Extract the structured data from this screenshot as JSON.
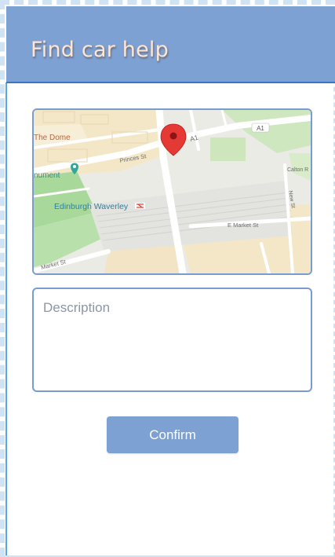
{
  "header": {
    "title": "Find car help"
  },
  "map": {
    "labels": {
      "the_dome": "The Dome",
      "princes_st": "Princes St",
      "a1_road": "A1",
      "a1_shield": "A1",
      "monument": "nument",
      "edinburgh_waverley": "Edinburgh Waverley",
      "calton_rd": "Calton R",
      "new_st": "New St",
      "e_market_st": "E Market St",
      "market_st": "Market St"
    },
    "pin_icon": "map-pin-icon",
    "rail_icon": "national-rail-icon",
    "monument_icon": "monument-pin-icon"
  },
  "description": {
    "placeholder": "Description",
    "value": ""
  },
  "confirm": {
    "label": "Confirm"
  },
  "colors": {
    "header": "#7ea1d3",
    "title": "#fde6d6",
    "button": "#7ea1d3",
    "border": "#7a9bcf"
  }
}
